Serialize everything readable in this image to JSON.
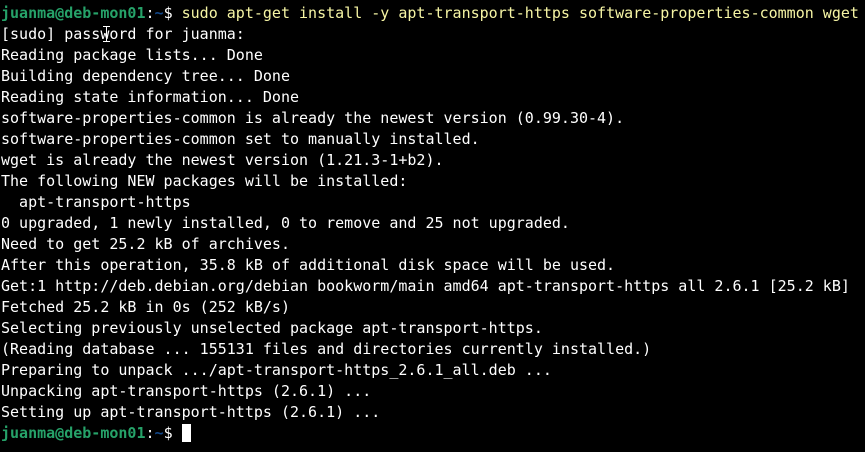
{
  "prompt": {
    "user_host": "juanma@deb-mon01",
    "separator": ":",
    "path": "~",
    "sign": "$ "
  },
  "command": "sudo apt-get install -y apt-transport-https software-properties-common wget",
  "output": [
    "[sudo] password for juanma:",
    "Reading package lists... Done",
    "Building dependency tree... Done",
    "Reading state information... Done",
    "software-properties-common is already the newest version (0.99.30-4).",
    "software-properties-common set to manually installed.",
    "wget is already the newest version (1.21.3-1+b2).",
    "The following NEW packages will be installed:",
    "  apt-transport-https",
    "0 upgraded, 1 newly installed, 0 to remove and 25 not upgraded.",
    "Need to get 25.2 kB of archives.",
    "After this operation, 35.8 kB of additional disk space will be used.",
    "Get:1 http://deb.debian.org/debian bookworm/main amd64 apt-transport-https all 2.6.1 [25.2 kB]",
    "Fetched 25.2 kB in 0s (252 kB/s)",
    "Selecting previously unselected package apt-transport-https.",
    "(Reading database ... 155131 files and directories currently installed.)",
    "Preparing to unpack .../apt-transport-https_2.6.1_all.deb ...",
    "Unpacking apt-transport-https (2.6.1) ...",
    "Setting up apt-transport-https (2.6.1) ..."
  ],
  "colors": {
    "background": "#000000",
    "prompt_user": "#26a269",
    "prompt_path": "#12488b",
    "command": "#f6f5a4",
    "text": "#ffffff"
  }
}
